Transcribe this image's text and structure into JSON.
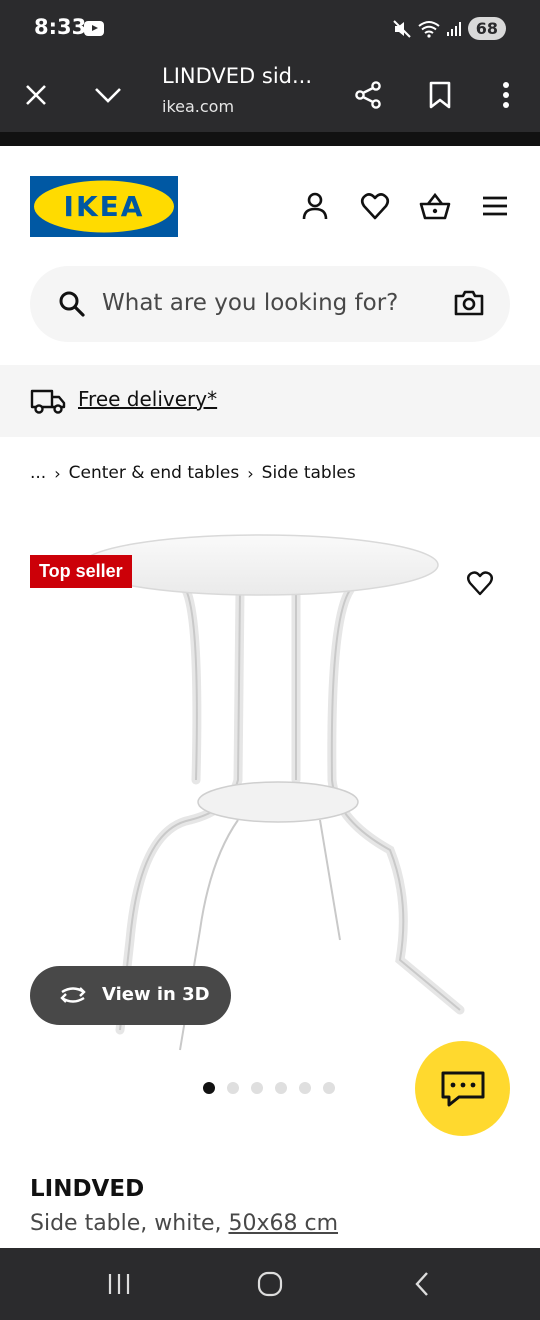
{
  "status": {
    "time": "8:33",
    "battery": "68"
  },
  "browser": {
    "title": "LINDVED sid...",
    "url": "ikea.com"
  },
  "brand": {
    "logo_text": "IKEA",
    "blue": "#0058a3",
    "yellow": "#ffdb00"
  },
  "header": {
    "icons": [
      "person-icon",
      "heart-icon",
      "basket-icon",
      "menu-icon"
    ]
  },
  "search": {
    "placeholder": "What are you looking for?"
  },
  "delivery": {
    "label": "Free delivery*"
  },
  "breadcrumb": {
    "ellipsis": "...",
    "items": [
      "Center & end tables",
      "Side tables"
    ]
  },
  "product": {
    "badge": "Top seller",
    "view3d_label": "View in 3D",
    "image_count": 6,
    "active_image": 1,
    "name": "LINDVED",
    "description": "Side table, white,",
    "size": "50x68 cm"
  },
  "colors": {
    "badge_red": "#cc0008",
    "chat_yellow": "#ffd92e",
    "system_dark": "#2b2b2d"
  }
}
